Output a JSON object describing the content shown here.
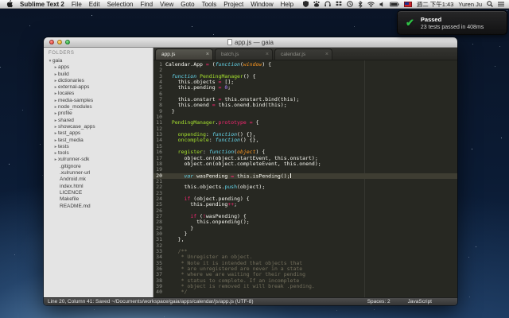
{
  "menubar": {
    "app_name": "Sublime Text 2",
    "menus": [
      "File",
      "Edit",
      "Selection",
      "Find",
      "View",
      "Goto",
      "Tools",
      "Project",
      "Window",
      "Help"
    ],
    "status_icons": [
      "shield-icon",
      "paw-icon",
      "headphones-icon",
      "dropbox-icon",
      "time-machine-icon",
      "bluetooth-icon",
      "wifi-icon",
      "volume-icon",
      "battery-icon",
      "input-flag-icon"
    ],
    "clock": "週二 下午1:43",
    "username": "Yuren Ju"
  },
  "notification": {
    "title": "Passed",
    "message": "23 tests passed in 408ms",
    "check_color": "#2fbf45"
  },
  "window": {
    "title": "app.js — gaia",
    "tabs": [
      {
        "label": "app.js",
        "active": true
      },
      {
        "label": "batch.js",
        "active": false
      },
      {
        "label": "calendar.js",
        "active": false
      }
    ],
    "sidebar": {
      "header": "FOLDERS",
      "root": "gaia",
      "folders": [
        "apps",
        "build",
        "dictionaries",
        "external-apps",
        "locales",
        "media-samples",
        "node_modules",
        "profile",
        "shared",
        "showcase_apps",
        "test_apps",
        "test_media",
        "tests",
        "tools",
        "xulrunner-sdk"
      ],
      "files": [
        ".gitignore",
        ".xulrunner-url",
        "Android.mk",
        "index.html",
        "LICENCE",
        "Makefile",
        "README.md"
      ]
    },
    "statusbar": {
      "left": "Line 20, Column 41: Saved ~/Documents/workspace/gaia/apps/calendar/js/app.js (UTF-8)",
      "spaces": "Spaces: 2",
      "syntax": "JavaScript"
    }
  },
  "editor": {
    "current_line": 20,
    "cursor_line": 20,
    "colors": {
      "background": "#272822",
      "foreground": "#f8f8f2",
      "keyword": "#f92672",
      "function_name": "#a6e22e",
      "storage": "#66d9ef",
      "number": "#ae81ff",
      "parameter": "#fd971f",
      "comment": "#75715e",
      "line_highlight": "#3e3d32",
      "gutter": "#8f908a"
    },
    "lines": [
      [
        [
          "fg",
          "Calendar.App "
        ],
        [
          "kw",
          "="
        ],
        [
          "fg",
          " ("
        ],
        [
          "st",
          "function"
        ],
        [
          "fg",
          "("
        ],
        [
          "param",
          "window"
        ],
        [
          "fg",
          ") {"
        ]
      ],
      [],
      [
        [
          "fg",
          "  "
        ],
        [
          "st",
          "function"
        ],
        [
          "fg",
          " "
        ],
        [
          "fn",
          "PendingManager"
        ],
        [
          "fg",
          "() {"
        ]
      ],
      [
        [
          "fg",
          "    this.objects "
        ],
        [
          "kw",
          "="
        ],
        [
          "fg",
          " [];"
        ]
      ],
      [
        [
          "fg",
          "    this.pending "
        ],
        [
          "kw",
          "="
        ],
        [
          "fg",
          " "
        ],
        [
          "num",
          "0"
        ],
        [
          "fg",
          ";"
        ]
      ],
      [],
      [
        [
          "fg",
          "    this.onstart "
        ],
        [
          "kw",
          "="
        ],
        [
          "fg",
          " this.onstart.bind(this);"
        ]
      ],
      [
        [
          "fg",
          "    this.onend "
        ],
        [
          "kw",
          "="
        ],
        [
          "fg",
          " this.onend.bind(this);"
        ]
      ],
      [
        [
          "fg",
          "  }"
        ]
      ],
      [],
      [
        [
          "fg",
          "  "
        ],
        [
          "fn",
          "PendingManager"
        ],
        [
          "fg",
          "."
        ],
        [
          "kw",
          "prototype"
        ],
        [
          "fg",
          " "
        ],
        [
          "kw",
          "="
        ],
        [
          "fg",
          " {"
        ]
      ],
      [],
      [
        [
          "fg",
          "    "
        ],
        [
          "fn",
          "onpending"
        ],
        [
          "fg",
          ": "
        ],
        [
          "st",
          "function"
        ],
        [
          "fg",
          "() {},"
        ]
      ],
      [
        [
          "fg",
          "    "
        ],
        [
          "fn",
          "oncomplete"
        ],
        [
          "fg",
          ": "
        ],
        [
          "st",
          "function"
        ],
        [
          "fg",
          "() {},"
        ]
      ],
      [],
      [
        [
          "fg",
          "    "
        ],
        [
          "fn",
          "register"
        ],
        [
          "fg",
          ": "
        ],
        [
          "st",
          "function"
        ],
        [
          "fg",
          "("
        ],
        [
          "param",
          "object"
        ],
        [
          "fg",
          ") {"
        ]
      ],
      [
        [
          "fg",
          "      object.on(object.startEvent, this.onstart);"
        ]
      ],
      [
        [
          "fg",
          "      object.on(object.completeEvent, this.onend);"
        ]
      ],
      [],
      [
        [
          "fg",
          "      "
        ],
        [
          "st",
          "var"
        ],
        [
          "fg",
          " wasPending "
        ],
        [
          "kw",
          "="
        ],
        [
          "fg",
          " this.isPending();"
        ]
      ],
      [],
      [
        [
          "fg",
          "      this.objects."
        ],
        [
          "sup",
          "push"
        ],
        [
          "fg",
          "(object);"
        ]
      ],
      [],
      [
        [
          "fg",
          "      "
        ],
        [
          "kw",
          "if"
        ],
        [
          "fg",
          " (object.pending) {"
        ]
      ],
      [
        [
          "fg",
          "        this.pending"
        ],
        [
          "kw",
          "++"
        ],
        [
          "fg",
          ";"
        ]
      ],
      [],
      [
        [
          "fg",
          "        "
        ],
        [
          "kw",
          "if"
        ],
        [
          "fg",
          " ("
        ],
        [
          "kw",
          "!"
        ],
        [
          "fg",
          "wasPending) {"
        ]
      ],
      [
        [
          "fg",
          "          this.onpending();"
        ]
      ],
      [
        [
          "fg",
          "        }"
        ]
      ],
      [
        [
          "fg",
          "      }"
        ]
      ],
      [
        [
          "fg",
          "    },"
        ]
      ],
      [],
      [
        [
          "cm",
          "    /**"
        ]
      ],
      [
        [
          "cm",
          "     * Unregister an object."
        ]
      ],
      [
        [
          "cm",
          "     * Note it is intended that objects that"
        ]
      ],
      [
        [
          "cm",
          "     * are unregistered are never in a state"
        ]
      ],
      [
        [
          "cm",
          "     * where we are waiting for their pending"
        ]
      ],
      [
        [
          "cm",
          "     * status to complete. If an incomplete"
        ]
      ],
      [
        [
          "cm",
          "     * object is removed it will break .pending."
        ]
      ],
      [
        [
          "cm",
          "     */"
        ]
      ]
    ]
  }
}
